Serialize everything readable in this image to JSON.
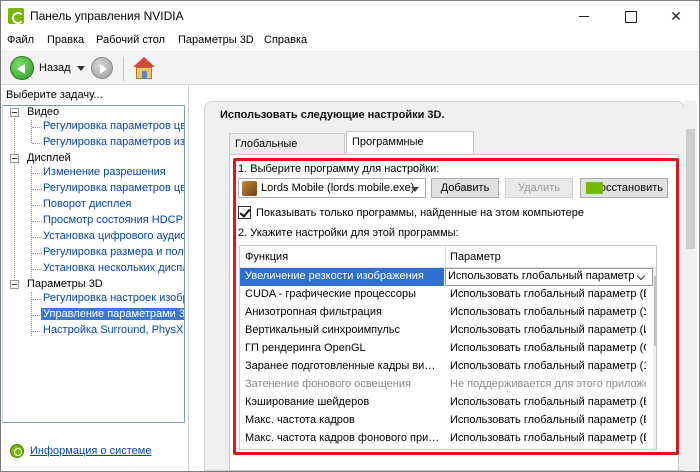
{
  "window": {
    "title": "Панель управления NVIDIA"
  },
  "menu": {
    "items": [
      "Файл",
      "Правка",
      "Рабочий стол",
      "Параметры 3D",
      "Справка"
    ]
  },
  "toolbar": {
    "back_label": "Назад"
  },
  "sidebar": {
    "title": "Выберите задачу...",
    "categories": [
      {
        "label": "Видео",
        "items": [
          "Регулировка параметров цвет",
          "Регулировка параметров изоб"
        ]
      },
      {
        "label": "Дисплей",
        "items": [
          "Изменение разрешения",
          "Регулировка параметров цвет",
          "Поворот дисплея",
          "Просмотр состояния HDCP",
          "Установка цифрового аудио",
          "Регулировка размера и положе",
          "Установка нескольких дисплеев"
        ]
      },
      {
        "label": "Параметры 3D",
        "items": [
          "Регулировка настроек изобра",
          "Управление параметрами 3D",
          "Настройка Surround, PhysX"
        ]
      }
    ],
    "selected_item": "Управление параметрами 3D",
    "info_link": "Информация о системе"
  },
  "main": {
    "heading": "Использовать следующие настройки 3D.",
    "tabs": [
      "Глобальные параметры",
      "Программные настройки"
    ],
    "active_tab": "Программные настройки",
    "step1_label": "1. Выберите программу для настройки:",
    "program_selected": "Lords Mobile (lords mobile.exe)",
    "buttons": {
      "add": "Добавить",
      "delete": "Удалить",
      "restore": "Восстановить"
    },
    "show_only_checkbox": {
      "label": "Показывать только программы, найденные на этом компьютере",
      "checked": true
    },
    "step2_label": "2. Укажите настройки для этой программы:",
    "table": {
      "columns": [
        "Функция",
        "Параметр"
      ],
      "rows": [
        {
          "function": "Увеличение резкости изображения",
          "param": "Использовать глобальный параметр (Вы"
        },
        {
          "function": "CUDA - графические процессоры",
          "param": "Использовать глобальный параметр (Все)"
        },
        {
          "function": "Анизотропная фильтрация",
          "param": "Использовать глобальный параметр (У..."
        },
        {
          "function": "Вертикальный синхроимпульс",
          "param": "Использовать глобальный параметр (И..."
        },
        {
          "function": "ГП рендеринга OpenGL",
          "param": "Использовать глобальный параметр (G..."
        },
        {
          "function": "Заранее подготовленные кадры вирту...",
          "param": "Использовать глобальный параметр (1)"
        },
        {
          "function": "Затенение фонового освещения",
          "param": "Не поддерживается для этого приложе..."
        },
        {
          "function": "Кэширование шейдеров",
          "param": "Использовать глобальный параметр (В..."
        },
        {
          "function": "Макс. частота кадров",
          "param": "Использовать глобальный параметр (В..."
        },
        {
          "function": "Макс. частота кадров фонового прило...",
          "param": "Использовать глобальный параметр (В..."
        }
      ]
    }
  },
  "colors": {
    "highlight": "#e0161b",
    "selection": "#2e6fd1",
    "nvidia_green": "#76b900"
  }
}
